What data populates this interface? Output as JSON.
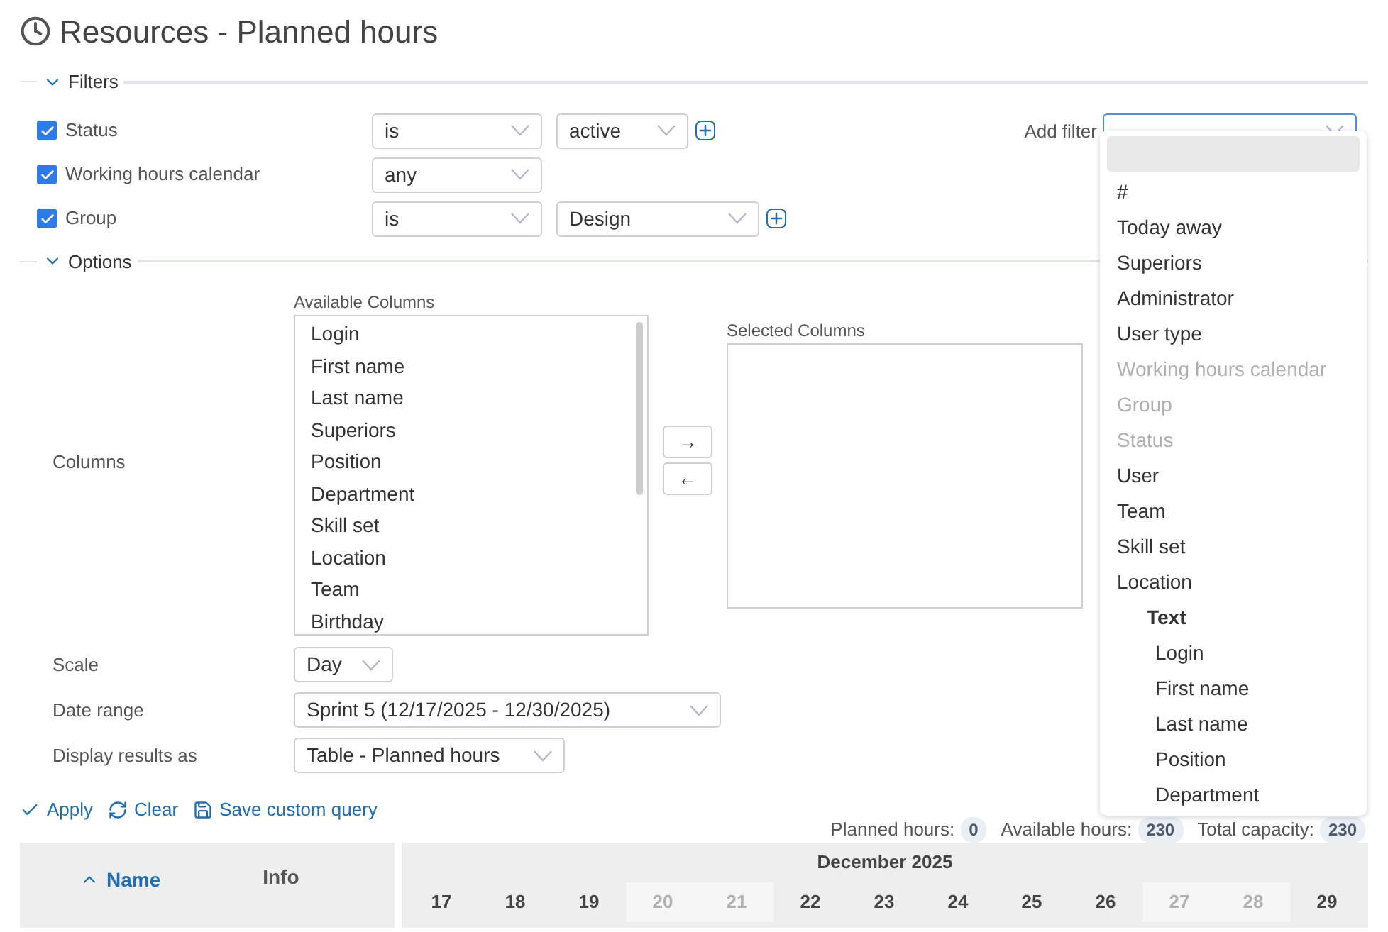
{
  "title": "Resources - Planned hours",
  "filters": {
    "legend": "Filters",
    "expanded": true,
    "rows": [
      {
        "label": "Status",
        "checked": true,
        "operator": "is",
        "value": "active",
        "can_add": true
      },
      {
        "label": "Working hours calendar",
        "checked": true,
        "operator": "any"
      },
      {
        "label": "Group",
        "checked": true,
        "operator": "is",
        "value": "Design",
        "can_add": true
      }
    ],
    "add_filter": {
      "label": "Add filter",
      "open": true
    }
  },
  "filter_menu": [
    {
      "kind": "blank",
      "selected": true
    },
    {
      "kind": "option",
      "label": "#",
      "disabled": false,
      "selected": false
    },
    {
      "kind": "option",
      "label": "Today away",
      "disabled": false,
      "selected": false
    },
    {
      "kind": "option",
      "label": "Superiors",
      "disabled": false,
      "selected": false
    },
    {
      "kind": "option",
      "label": "Administrator",
      "disabled": false,
      "selected": false
    },
    {
      "kind": "option",
      "label": "User type",
      "disabled": false,
      "selected": false
    },
    {
      "kind": "option",
      "label": "Working hours calendar",
      "disabled": true,
      "selected": false
    },
    {
      "kind": "option",
      "label": "Group",
      "disabled": true,
      "selected": false
    },
    {
      "kind": "option",
      "label": "Status",
      "disabled": true,
      "selected": false
    },
    {
      "kind": "option",
      "label": "User",
      "disabled": false,
      "selected": false
    },
    {
      "kind": "option",
      "label": "Team",
      "disabled": false,
      "selected": false
    },
    {
      "kind": "option",
      "label": "Skill set",
      "disabled": false,
      "selected": false
    },
    {
      "kind": "option",
      "label": "Location",
      "disabled": false,
      "selected": false
    },
    {
      "kind": "group",
      "label": "Text",
      "children": [
        {
          "kind": "option",
          "label": "Login",
          "disabled": false,
          "selected": false
        },
        {
          "kind": "option",
          "label": "First name",
          "disabled": false,
          "selected": false
        },
        {
          "kind": "option",
          "label": "Last name",
          "disabled": false,
          "selected": false
        },
        {
          "kind": "option",
          "label": "Position",
          "disabled": false,
          "selected": false
        },
        {
          "kind": "option",
          "label": "Department",
          "disabled": false,
          "selected": false
        }
      ]
    }
  ],
  "options": {
    "legend": "Options",
    "expanded": true,
    "columns_label": "Columns",
    "available": {
      "label": "Available Columns",
      "items": [
        "Login",
        "First name",
        "Last name",
        "Superiors",
        "Position",
        "Department",
        "Skill set",
        "Location",
        "Team",
        "Birthday"
      ]
    },
    "move_buttons": [
      "→",
      "←"
    ],
    "selected": {
      "label": "Selected Columns"
    },
    "scale": {
      "label": "Scale",
      "value": "Day"
    },
    "date_range": {
      "label": "Date range",
      "value": "Sprint 5 (12/17/2025 - 12/30/2025)"
    },
    "display_as": {
      "label": "Display results as",
      "value": "Table - Planned hours"
    }
  },
  "actions": [
    {
      "kind": "apply",
      "label": "Apply"
    },
    {
      "kind": "clear",
      "label": "Clear"
    },
    {
      "kind": "save",
      "label": "Save custom query"
    }
  ],
  "summary": [
    {
      "label": "Planned hours:",
      "value": "0"
    },
    {
      "label": "Available hours:",
      "value": "230"
    },
    {
      "label": "Total capacity:",
      "value": "230"
    }
  ],
  "table": {
    "name_heading": "Name",
    "sort_ascending": true,
    "info_heading": "Info",
    "month": "December 2025",
    "days": [
      {
        "label": "17",
        "weekend": false
      },
      {
        "label": "18",
        "weekend": false
      },
      {
        "label": "19",
        "weekend": false
      },
      {
        "label": "20",
        "weekend": true
      },
      {
        "label": "21",
        "weekend": true
      },
      {
        "label": "22",
        "weekend": false
      },
      {
        "label": "23",
        "weekend": false
      },
      {
        "label": "24",
        "weekend": false
      },
      {
        "label": "25",
        "weekend": false
      },
      {
        "label": "26",
        "weekend": false
      },
      {
        "label": "27",
        "weekend": true
      },
      {
        "label": "28",
        "weekend": true
      },
      {
        "label": "29",
        "weekend": false
      }
    ]
  }
}
